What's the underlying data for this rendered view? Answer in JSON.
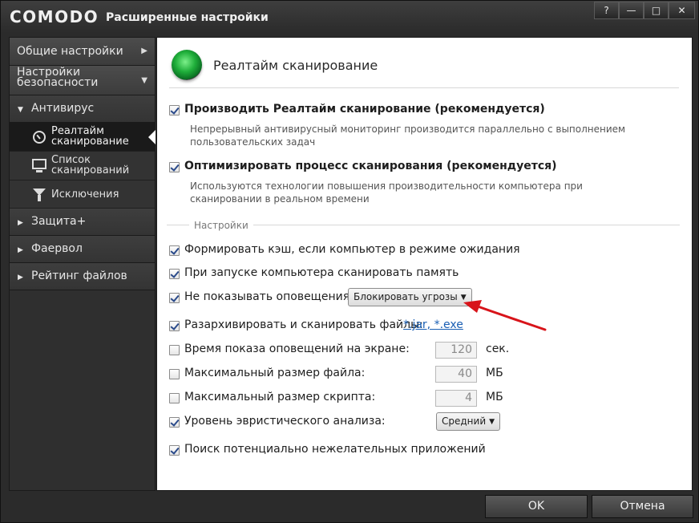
{
  "window": {
    "brand": "COMODO",
    "title": "Расширенные настройки",
    "buttons": {
      "help": "?",
      "minimize": "—",
      "maximize": "□",
      "close": "✕"
    }
  },
  "nav": {
    "general": "Общие настройки",
    "security_line1": "Настройки",
    "security_line2": "безопасности",
    "antivirus": "Антивирус",
    "realtime_line1": "Реалтайм",
    "realtime_line2": "сканирование",
    "scanlist_line1": "Список",
    "scanlist_line2": "сканирований",
    "exclusions": "Исключения",
    "defense": "Защита+",
    "firewall": "Фаервол",
    "file_rating": "Рейтинг файлов"
  },
  "panel": {
    "title": "Реалтайм сканирование",
    "opt_realtime": {
      "label": "Производить Реалтайм сканирование (рекомендуется)",
      "checked": true,
      "desc": "Непрерывный антивирусный мониторинг производится параллельно с выполнением пользовательских задач"
    },
    "opt_optimize": {
      "label": "Оптимизировать процесс сканирования (рекомендуется)",
      "checked": true,
      "desc": "Используются технологии повышения производительности компьютера при сканировании в реальном времени"
    },
    "section_label": "Настройки",
    "cache": {
      "label": "Формировать кэш, если компьютер в режиме ожидания",
      "checked": true
    },
    "memory": {
      "label": "При запуске компьютера сканировать память",
      "checked": true
    },
    "no_alerts": {
      "label": "Не показывать оповещения",
      "checked": true,
      "dropdown": "Блокировать угрозы"
    },
    "unpack": {
      "label": "Разархивировать и сканировать файлы:",
      "checked": true,
      "link": "*.jar, *.exe"
    },
    "alert_time": {
      "label": "Время показа оповещений на экране:",
      "checked": false,
      "value": "120",
      "unit": "сек."
    },
    "max_file": {
      "label": "Максимальный размер файла:",
      "checked": false,
      "value": "40",
      "unit": "МБ"
    },
    "max_script": {
      "label": "Максимальный размер скрипта:",
      "checked": false,
      "value": "4",
      "unit": "МБ"
    },
    "heuristics": {
      "label": "Уровень эвристического анализа:",
      "checked": true,
      "dropdown": "Средний"
    },
    "pua": {
      "label": "Поиск потенциально нежелательных приложений",
      "checked": true
    }
  },
  "footer": {
    "ok": "OK",
    "cancel": "Отмена"
  },
  "colors": {
    "annotation_arrow": "#d8141a",
    "link": "#1a5fb4"
  }
}
